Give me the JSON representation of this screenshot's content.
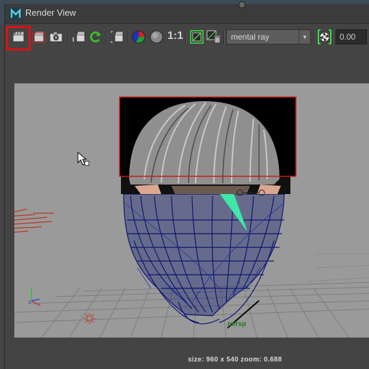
{
  "window": {
    "title": "Render View"
  },
  "toolbar": {
    "buttons": [
      {
        "name": "redo-previous-render-icon"
      },
      {
        "name": "render-region-icon"
      },
      {
        "name": "snapshot-icon"
      },
      {
        "name": "ipr-render-icon"
      },
      {
        "name": "refresh-ipr-icon"
      },
      {
        "name": "ipr-region-icon"
      },
      {
        "name": "display-rgb-icon"
      },
      {
        "name": "display-alpha-icon"
      },
      {
        "name": "keep-image-icon"
      },
      {
        "name": "remove-image-icon"
      },
      {
        "name": "exposure-icon"
      }
    ],
    "ratio_label": "1:1",
    "renderer": "mental ray",
    "exposure_value": "0.00",
    "highlight_color": "#e01010"
  },
  "viewport": {
    "camera_label": "persp",
    "status": "size: 960 x 540 zoom: 0.688",
    "render_region_color": "#cc1a1a",
    "wireframe_color": "#0a1470",
    "selected_wire_color": "#3ee8a8"
  }
}
